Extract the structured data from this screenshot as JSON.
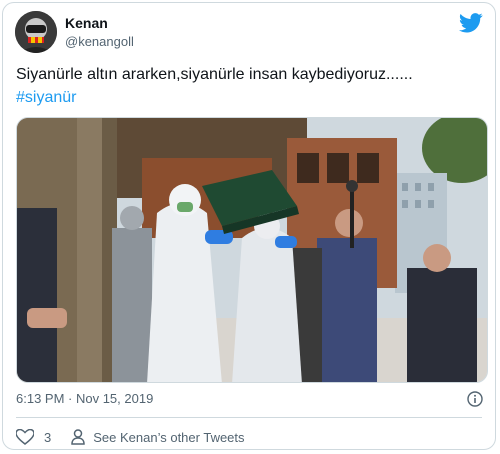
{
  "author": {
    "name": "Kenan",
    "handle": "@kenangoll",
    "avatar_icon": "avatar-icon"
  },
  "tweet": {
    "text": "Siyanürle altın ararken,siyanürle insan kaybediyoruz......",
    "hashtag": "#siyanür",
    "photo_alt": "Funeral procession with people in white protective suits carrying a green-draped coffin"
  },
  "meta": {
    "timestamp": "6:13 PM · Nov 15, 2019"
  },
  "actions": {
    "like_count": "3",
    "see_more_label": "See Kenan’s other Tweets"
  },
  "colors": {
    "accent": "#1d9bf0",
    "text": "#0f1419",
    "muted": "#536471",
    "border": "#cfd9de"
  }
}
